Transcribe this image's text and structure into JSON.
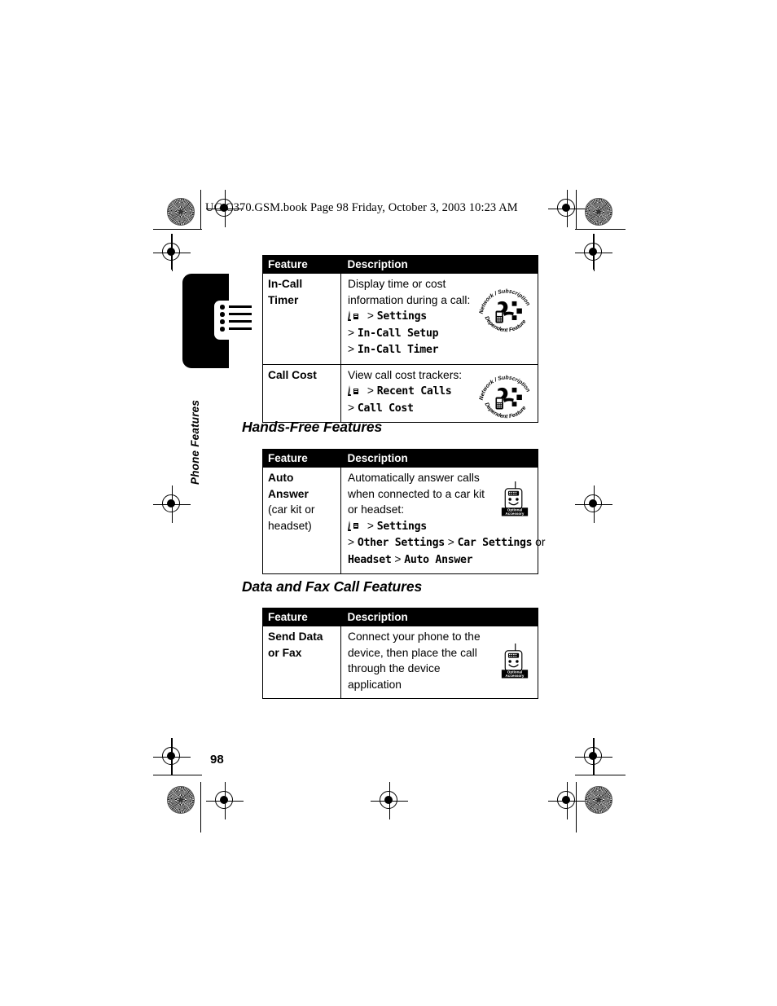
{
  "page": {
    "header_line": "UG.C370.GSM.book  Page 98  Friday, October 3, 2003  10:23 AM",
    "number": "98",
    "side_tab_label": "Phone Features"
  },
  "icons": {
    "menu_key": "menu-key-icon",
    "list": "bulleted-list-icon",
    "network_badge": "network-subscription-dependent-feature-icon",
    "optional_badge": "optional-accessory-icon",
    "registration": "registration-crosshair-icon",
    "starburst": "density-starburst-icon"
  },
  "badges": {
    "network": {
      "top_text": "Network / Subscription",
      "bottom_text": "Dependent  Feature"
    },
    "optional": {
      "line1": "Optional",
      "line2": "Accessory"
    }
  },
  "tables": {
    "headers": {
      "feature": "Feature",
      "description": "Description"
    },
    "call_features": {
      "rows": [
        {
          "feature_lines": [
            "In-Call",
            "Timer"
          ],
          "desc_lines": [
            "Display time or cost",
            "information during a call:"
          ],
          "menu_lines": [
            {
              "key_icon": true,
              "arrow": ">",
              "path": "Settings"
            },
            {
              "key_icon": false,
              "arrow": ">",
              "path": "In-Call Setup"
            },
            {
              "key_icon": false,
              "arrow": ">",
              "path": "In-Call Timer"
            }
          ],
          "badge": "network"
        },
        {
          "feature_lines": [
            "Call Cost"
          ],
          "desc_lines": [
            "View call cost trackers:"
          ],
          "menu_lines": [
            {
              "key_icon": true,
              "arrow": ">",
              "path": "Recent Calls"
            },
            {
              "key_icon": false,
              "arrow": ">",
              "path": "Call Cost"
            }
          ],
          "badge": "network"
        }
      ]
    },
    "hands_free": {
      "heading": "Hands-Free Features",
      "rows": [
        {
          "feature_lines": [
            "Auto",
            "Answer"
          ],
          "feature_plain_lines": [
            "(car kit or",
            "headset)"
          ],
          "desc_lines": [
            "Automatically answer calls",
            "when connected to a car kit",
            "or headset:"
          ],
          "menu_lines": [
            {
              "key_icon": true,
              "arrow": ">",
              "path": "Settings"
            },
            {
              "key_icon": false,
              "arrow": ">",
              "path": "Other Settings",
              "arrow2": ">",
              "path2": "Car Settings",
              "suffix": " or"
            },
            {
              "key_icon": false,
              "path": "Headset",
              "arrow2": ">",
              "path2": "Auto Answer"
            }
          ],
          "badge": "optional"
        }
      ]
    },
    "data_fax": {
      "heading": "Data and Fax Call Features",
      "rows": [
        {
          "feature_lines": [
            "Send Data",
            "or Fax"
          ],
          "desc_lines": [
            "Connect your phone to the",
            "device, then place the call",
            "through the device",
            "application"
          ],
          "menu_lines": [],
          "badge": "optional"
        }
      ]
    }
  }
}
